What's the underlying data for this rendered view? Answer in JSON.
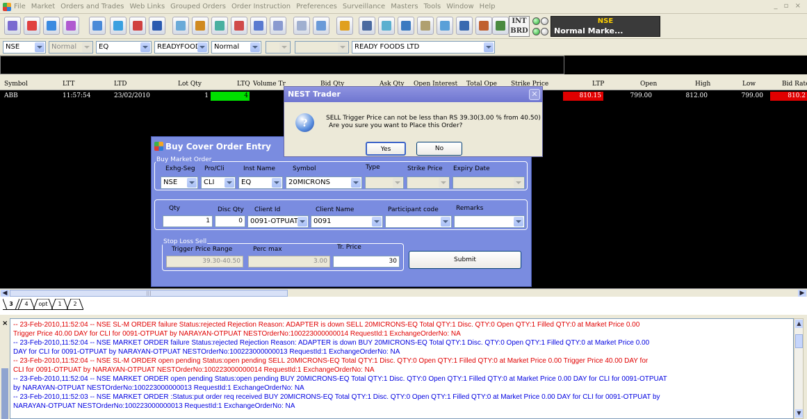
{
  "menu": [
    "File",
    "Market",
    "Orders and Trades",
    "Web Links",
    "Grouped Orders",
    "Order Instruction",
    "Preferences",
    "Surveillance",
    "Masters",
    "Tools",
    "Window",
    "Help"
  ],
  "window_controls": "_ ▫ ×",
  "toolbar": {
    "indicator_int": "INT",
    "indicator_brd": "BRD",
    "exchange": "NSE",
    "market_status": "Normal Marke..."
  },
  "filters": {
    "exchange": "NSE",
    "mode": "Normal",
    "inst": "EQ",
    "symbol": "READYFOOD",
    "series_type": "Normal",
    "company": "READY FOODS LTD"
  },
  "market_watch": {
    "headers": [
      "Symbol",
      "LTT",
      "LTD",
      "Lot Qty",
      "LTQ",
      "Volume Tr",
      "Bid Qty",
      "Ask Qty",
      "Open Interest",
      "Total Ope",
      "Strike Price",
      "LTP",
      "Open",
      "High",
      "Low",
      "Bid Rate"
    ],
    "row": {
      "symbol": "ABB",
      "ltt": "11:57:54",
      "ltd": "23/02/2010",
      "lot_qty": "1",
      "ltq": "4",
      "ltp": "810.15",
      "open": "799.00",
      "high": "812.00",
      "low": "799.00",
      "bid_rate": "810.2"
    }
  },
  "tabs": [
    "3",
    "4",
    "opt",
    "1",
    "2"
  ],
  "order_window": {
    "title": "Buy Cover Order Entry",
    "group_market": "Buy Market Order",
    "labels": {
      "exhg_seg": "Exhg-Seg",
      "pro_cli": "Pro/Cli",
      "inst_name": "Inst Name",
      "symbol": "Symbol",
      "type": "Type",
      "strike_price": "Strike Price",
      "expiry_date": "Expiry Date",
      "qty": "Qty",
      "disc_qty": "Disc Qty",
      "client_id": "Client Id",
      "client_name": "Client Name",
      "participant_code": "Participant code",
      "remarks": "Remarks"
    },
    "values": {
      "exhg_seg": "NSE",
      "pro_cli": "CLI",
      "inst_name": "EQ",
      "symbol": "20MICRONS",
      "qty": "1",
      "disc_qty": "0",
      "client_id": "0091-OTPUAT",
      "client_name": "0091"
    },
    "stop_loss": {
      "group": "Stop Loss Sell",
      "trigger_label": "Trigger Price Range",
      "perc_label": "Perc max",
      "tr_price_label": "Tr. Price",
      "trigger_range": "39.30-40.50",
      "perc_max": "3.00",
      "tr_price": "30"
    },
    "submit": "Submit"
  },
  "dialog": {
    "title": "NEST Trader",
    "line1": "SELL Trigger Price can not be less than RS 39.30(3.00 % from 40.50)",
    "line2": "Are you sure you want to Place this Order?",
    "yes": "Yes",
    "no": "No"
  },
  "log": [
    {
      "color": "red",
      "text": "-- 23-Feb-2010,11:52:04 --  NSE SL-M ORDER failure Status:rejected  Rejection Reason:  ADAPTER is down  SELL  20MICRONS-EQ  Total QTY:1  Disc. QTY:0  Open QTY:1  Filled QTY:0  at Market Price  0.00"
    },
    {
      "color": "red",
      "text": "Trigger Price  40.00  DAY for CLI for 0091-OTPUAT by NARAYAN-OTPUAT   NESTOrderNo:100223000000014  RequestId:1      ExchangeOrderNo: NA"
    },
    {
      "color": "blue",
      "text": "-- 23-Feb-2010,11:52:04 --  NSE MARKET ORDER failure Status:rejected  Rejection Reason:  ADAPTER is down  BUY  20MICRONS-EQ  Total QTY:1  Disc. QTY:0  Open QTY:1  Filled QTY:0  at Market Price  0.00"
    },
    {
      "color": "blue",
      "text": "DAY  for CLI for 0091-OTPUAT by NARAYAN-OTPUAT   NESTOrderNo:100223000000013  RequestId:1      ExchangeOrderNo: NA"
    },
    {
      "color": "red",
      "text": "-- 23-Feb-2010,11:52:04 --  NSE SL-M ORDER open pending Status:open pending  SELL  20MICRONS-EQ  Total QTY:1  Disc. QTY:0  Open QTY:1  Filled QTY:0  at Market Price  0.00  Trigger Price  40.00  DAY for"
    },
    {
      "color": "red",
      "text": "CLI for 0091-OTPUAT by NARAYAN-OTPUAT   NESTOrderNo:100223000000014  RequestId:1      ExchangeOrderNo: NA"
    },
    {
      "color": "blue",
      "text": "-- 23-Feb-2010,11:52:04 --  NSE MARKET ORDER open pending Status:open pending  BUY  20MICRONS-EQ  Total QTY:1  Disc. QTY:0  Open QTY:1  Filled QTY:0  at Market Price  0.00  DAY for CLI for 0091-OTPUAT"
    },
    {
      "color": "blue",
      "text": "by NARAYAN-OTPUAT   NESTOrderNo:100223000000013  RequestId:1      ExchangeOrderNo: NA"
    },
    {
      "color": "blue",
      "text": "-- 23-Feb-2010,11:52:03 --  NSE MARKET ORDER :Status:put order req received  BUY  20MICRONS-EQ  Total QTY:1  Disc. QTY:0  Open QTY:1  Filled QTY:0  at Market Price  0.00  DAY for CLI for 0091-OTPUAT by"
    },
    {
      "color": "blue",
      "text": "NARAYAN-OTPUAT   NESTOrderNo:100223000000013  RequestId:1      ExchangeOrderNo: NA"
    }
  ],
  "icons": [
    "app-icon",
    "toolbar-icons",
    "question-icon",
    "close-icon",
    "dropdown-arrow-icon"
  ],
  "colors": {
    "ltq_bg": "#00e000",
    "ltp_bg": "#e00000",
    "window_blue": "#7a8ce0",
    "log_red": "#e00000",
    "log_blue": "#0000e0"
  }
}
